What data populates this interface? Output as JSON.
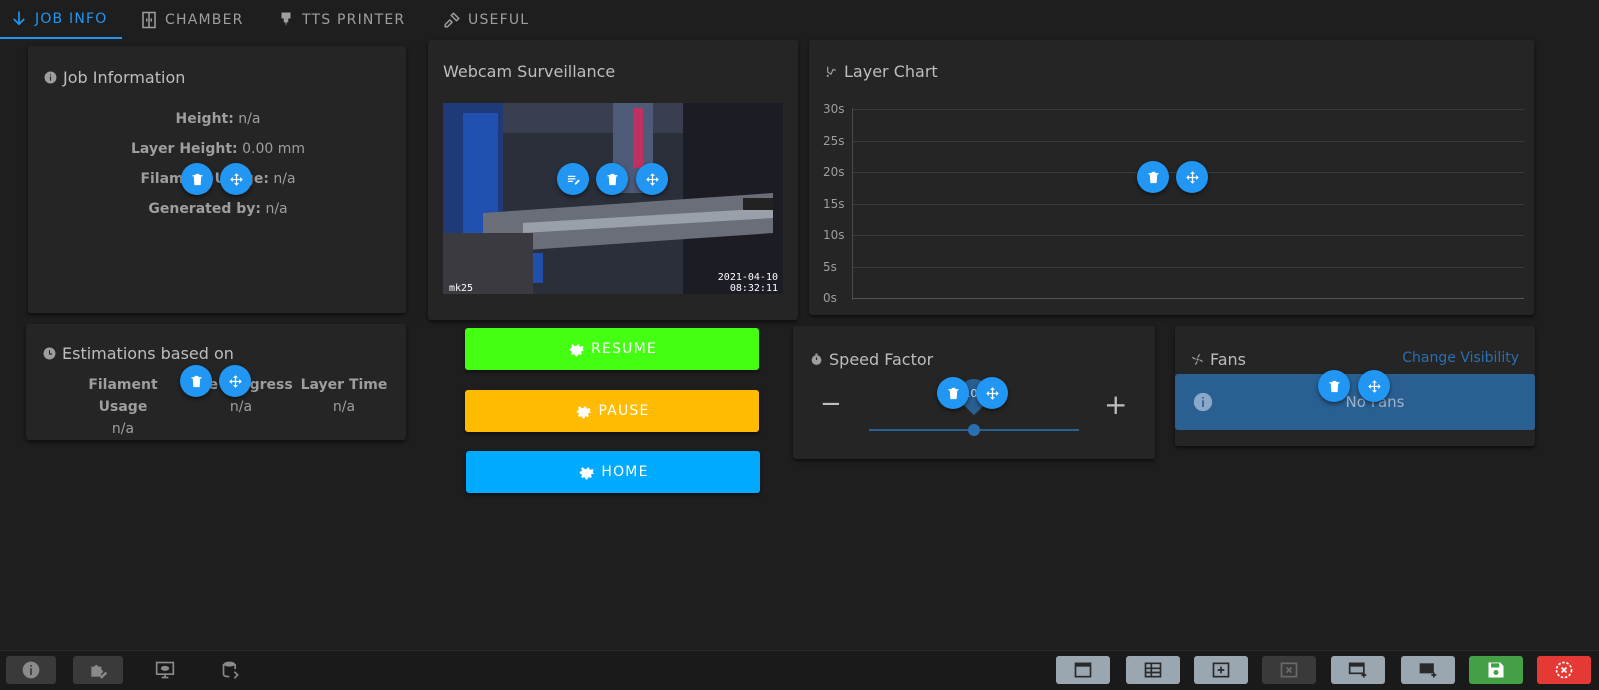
{
  "tabs": [
    {
      "label": "JOB INFO",
      "icon": "download-arrow-icon",
      "active": true
    },
    {
      "label": "CHAMBER",
      "icon": "door-icon",
      "active": false
    },
    {
      "label": "TTS PRINTER",
      "icon": "printer-nozzle-icon",
      "active": false
    },
    {
      "label": "USEFUL",
      "icon": "tools-icon",
      "active": false
    }
  ],
  "job_info": {
    "title": "Job Information",
    "rows": [
      {
        "label": "Height:",
        "value": "n/a"
      },
      {
        "label": "Layer Height:",
        "value": "0.00 mm"
      },
      {
        "label": "Filament Usage:",
        "value": "n/a"
      },
      {
        "label": "Generated by:",
        "value": "n/a"
      }
    ]
  },
  "estimations": {
    "title": "Estimations based on",
    "columns": [
      {
        "label_line1": "Filament",
        "label_line2": "Usage",
        "value": "n/a"
      },
      {
        "label_line1": "File Progress",
        "label_line2": "",
        "value": "n/a"
      },
      {
        "label_line1": "Layer Time",
        "label_line2": "",
        "value": "n/a"
      }
    ]
  },
  "webcam": {
    "title": "Webcam Surveillance",
    "overlay_date": "2021-04-10",
    "overlay_time": "08:32:11",
    "overlay_label": "mk25"
  },
  "macros": [
    {
      "label": "RESUME",
      "color": "#44ff11"
    },
    {
      "label": "PAUSE",
      "color": "#ffbb00"
    },
    {
      "label": "HOME",
      "color": "#00aaff"
    }
  ],
  "layer_chart": {
    "title": "Layer Chart"
  },
  "chart_data": {
    "type": "line",
    "title": "Layer Chart",
    "y_ticks": [
      "30s",
      "25s",
      "20s",
      "15s",
      "10s",
      "5s",
      "0s"
    ],
    "ylim": [
      0,
      30
    ],
    "series": [],
    "grid": true
  },
  "speed_factor": {
    "title": "Speed Factor",
    "value_label": "100",
    "slider_fraction": 0.5,
    "minus": "−",
    "plus": "+"
  },
  "fans": {
    "title": "Fans",
    "change_visibility": "Change Visibility",
    "empty_message": "No Fans"
  },
  "colors": {
    "accent": "#2196f3",
    "background": "#1e1e1e",
    "card": "#252525",
    "fans_alert": "#2a5f92",
    "save": "#43a047",
    "close": "#e53935"
  }
}
